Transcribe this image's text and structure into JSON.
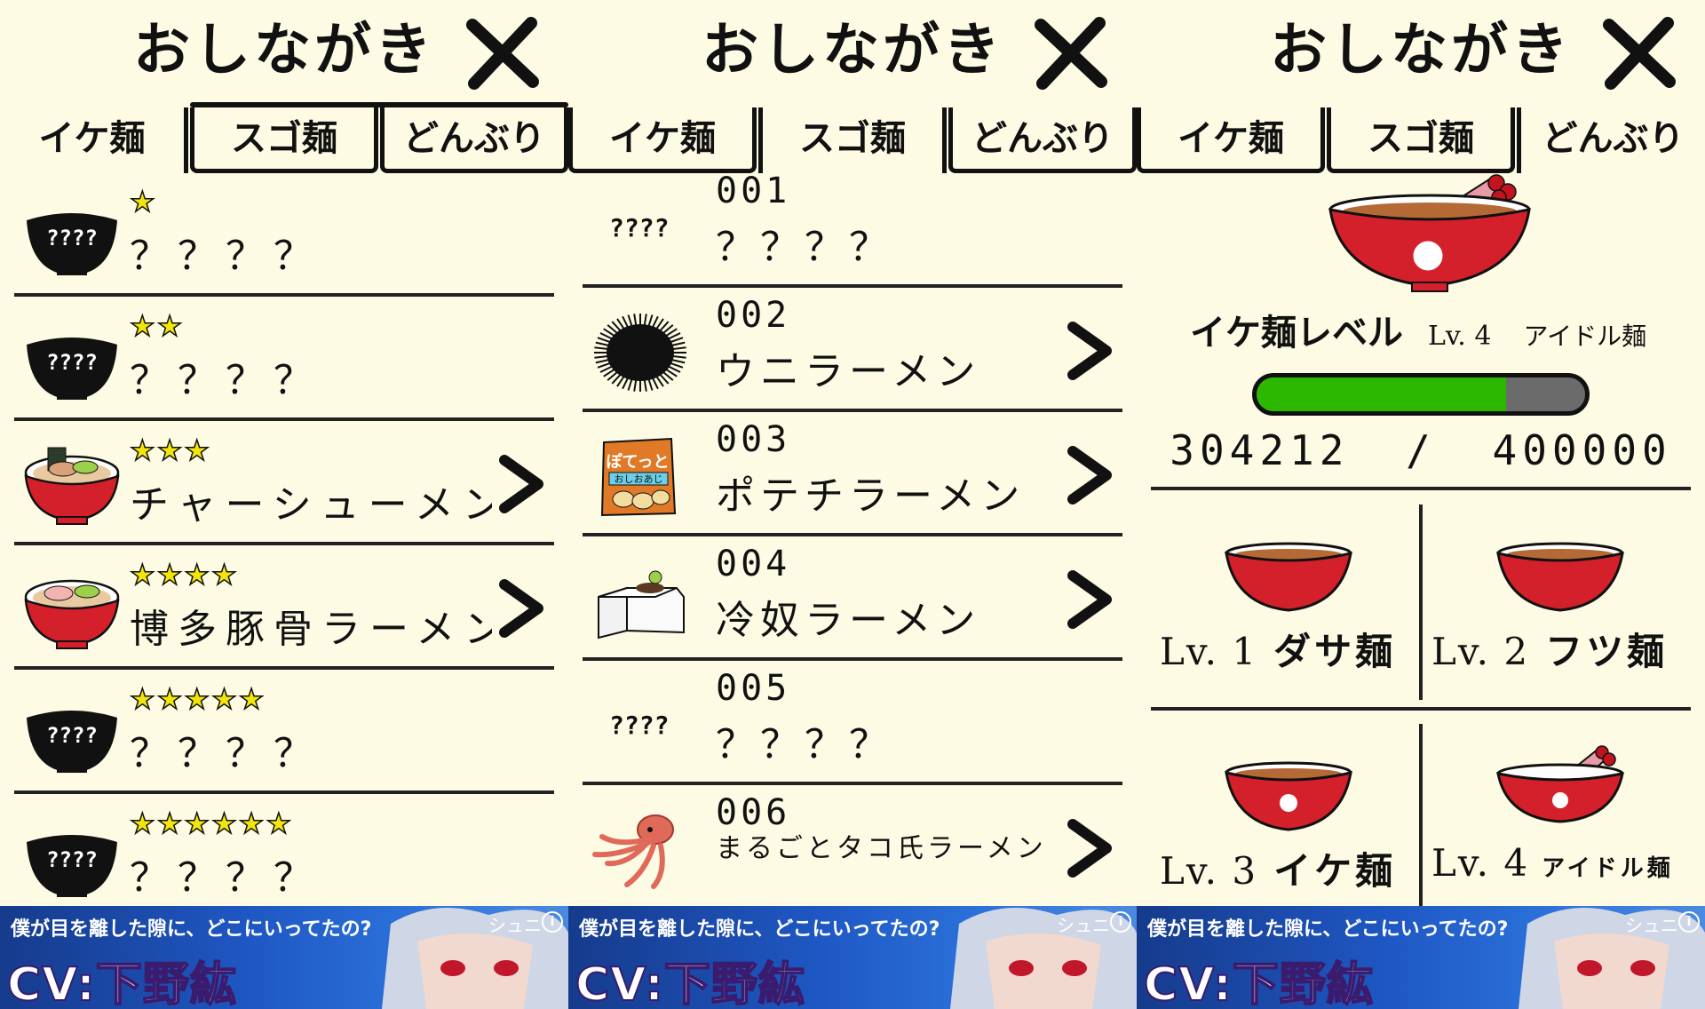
{
  "title": "おしながき",
  "tabs": [
    "イケ麺",
    "スゴ麺",
    "どんぶり"
  ],
  "screen1": {
    "active_tab": 0,
    "items": [
      {
        "stars": "★",
        "name": "？？？？",
        "unknown": true,
        "thumb_label": "????"
      },
      {
        "stars": "★★",
        "name": "？？？？",
        "unknown": true,
        "thumb_label": "????"
      },
      {
        "stars": "★★★",
        "name": "チャーシューメン",
        "unknown": false,
        "thumb": "ramen-bowl-chashu"
      },
      {
        "stars": "★★★★",
        "name": "博多豚骨ラーメン",
        "unknown": false,
        "thumb": "ramen-bowl-tonkotsu"
      },
      {
        "stars": "★★★★★",
        "name": "？？？？",
        "unknown": true,
        "thumb_label": "????"
      },
      {
        "stars": "★★★★★★",
        "name": "？？？？",
        "unknown": true,
        "thumb_label": "????"
      }
    ]
  },
  "screen2": {
    "active_tab": 1,
    "items": [
      {
        "num": "001",
        "name": "？？？？",
        "unknown": true,
        "thumb_label": "????"
      },
      {
        "num": "002",
        "name": "ウニラーメン",
        "unknown": false,
        "thumb": "sea-urchin-icon"
      },
      {
        "num": "003",
        "name": "ポテチラーメン",
        "unknown": false,
        "thumb": "potato-chips-bag-icon",
        "bag_text_1": "ぽてっと",
        "bag_text_2": "おしおあじ"
      },
      {
        "num": "004",
        "name": "冷奴ラーメン",
        "unknown": false,
        "thumb": "tofu-icon"
      },
      {
        "num": "005",
        "name": "？？？？",
        "unknown": true,
        "thumb_label": "????"
      },
      {
        "num": "006",
        "name": "まるごとタコ氏ラーメン",
        "unknown": false,
        "thumb": "octopus-icon"
      }
    ]
  },
  "screen3": {
    "active_tab": 2,
    "level_title": "イケ麺レベル",
    "level_lv": "Lv. 4",
    "level_name": "アイドル麺",
    "xp_current": "304212",
    "xp_sep": "/",
    "xp_max": "400000",
    "xp_progress": 0.76,
    "levels": [
      {
        "lv": "Lv. 1",
        "name": "ダサ麺"
      },
      {
        "lv": "Lv. 2",
        "name": "フツ麺"
      },
      {
        "lv": "Lv. 3",
        "name": "イケ麺"
      },
      {
        "lv": "Lv. 4",
        "name": "アイドル麺"
      }
    ]
  },
  "ad": {
    "tagline": "僕が目を離した隙に、どこにいってたの?",
    "cv": "CV:下野紘",
    "brand": "シュニ",
    "info": "i"
  },
  "colors": {
    "background": "#fdfbe3",
    "star": "#f2e50c",
    "bowl_red": "#d4202a",
    "xp_green": "#2db800",
    "xp_track": "#6b6b6b"
  }
}
